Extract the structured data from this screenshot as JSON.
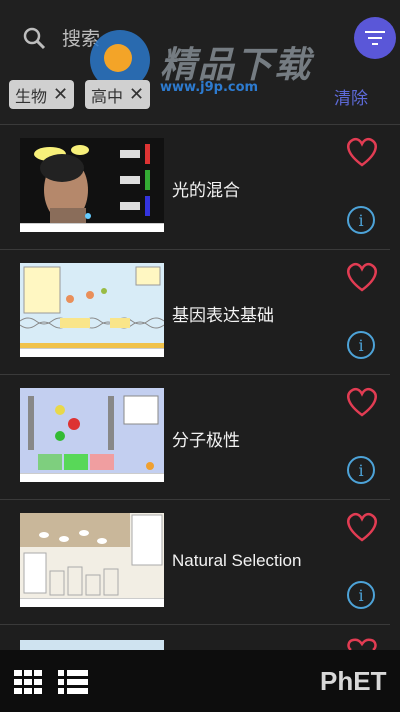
{
  "header": {
    "search_label": "搜索",
    "clear_label": "清除",
    "chips": [
      {
        "label": "生物"
      },
      {
        "label": "高中"
      }
    ]
  },
  "watermark": {
    "text": "精品下载",
    "url": "www.j9p.com"
  },
  "simulations": [
    {
      "title": "光的混合"
    },
    {
      "title": "基因表达基础"
    },
    {
      "title": "分子极性"
    },
    {
      "title": "Natural Selection"
    }
  ],
  "footer": {
    "brand": "PhET"
  },
  "colors": {
    "accent": "#5a57d8",
    "heart": "#e23c53",
    "info": "#4da3d8",
    "clear": "#5d6ad8"
  }
}
